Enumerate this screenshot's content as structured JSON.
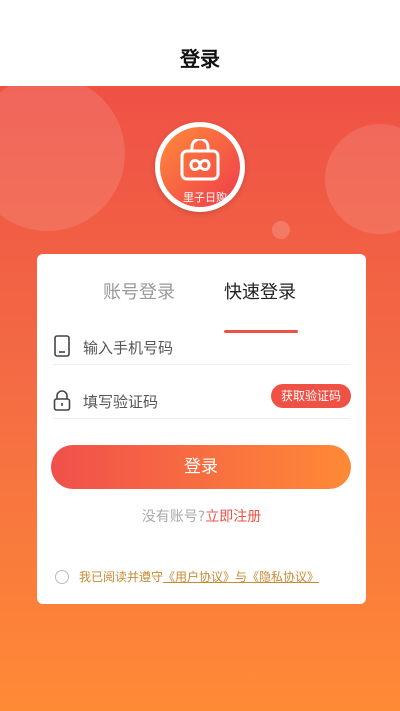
{
  "header": {
    "title": "登录"
  },
  "logo": {
    "text": "里子日购"
  },
  "tabs": [
    {
      "label": "账号登录",
      "active": false
    },
    {
      "label": "快速登录",
      "active": true
    }
  ],
  "form": {
    "phone_placeholder": "输入手机号码",
    "code_placeholder": "填写验证码",
    "get_code_label": "获取验证码",
    "login_label": "登录"
  },
  "register": {
    "prompt": "没有账号?",
    "link": "立即注册"
  },
  "agreement": {
    "prefix": "我已阅读并遵守",
    "user_agreement": "《用户协议》",
    "and": "与",
    "privacy": "《隐私协议》"
  },
  "colors": {
    "accent": "#ef5145",
    "gradient_end": "#ff8a36"
  }
}
